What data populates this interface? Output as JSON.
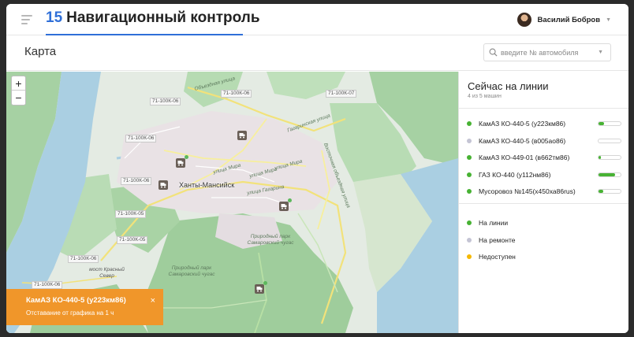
{
  "header": {
    "brand_num": "15",
    "brand_title": "Навигационный контроль",
    "user_name": "Василий Бобров"
  },
  "page": {
    "title": "Карта",
    "search_placeholder": "введите № автомобиля"
  },
  "map": {
    "zoom_in": "+",
    "zoom_out": "−",
    "city": "Ханты-Мансийск",
    "road_labels": [
      "71-100К-06",
      "71-100К-06",
      "71-100К-07",
      "71-100К-06",
      "71-100К-06",
      "71-100К-05",
      "71-100К-06",
      "71-100К-06",
      "71-100К-05"
    ],
    "park_label_1": "Природный парк Самаровский чугас",
    "park_label_2": "Природный парк Самаровский чугас",
    "bridge_label": "мост Красный Север",
    "street_labels": [
      "Объездная улица",
      "Гагаринская улица",
      "улица Мира",
      "улица Мира",
      "улица Мира",
      "Восточная объездная улица",
      "улица Гагарина"
    ]
  },
  "toast": {
    "title": "КамАЗ КО-440-5 (у223км86)",
    "message": "Отставание от графика на 1 ч",
    "close": "×"
  },
  "panel": {
    "title": "Сейчас на линии",
    "subtitle": "4 из 5 машин",
    "vehicles": [
      {
        "name": "КамАЗ КО-440-5 (у223км86)",
        "status_color": "#47b233",
        "progress": 0.25
      },
      {
        "name": "КамАЗ КО-440-5 (в005ао86)",
        "status_color": "#c4c4d4",
        "progress": null
      },
      {
        "name": "КамАЗ КО-449-01 (в662тм86)",
        "status_color": "#47b233",
        "progress": 0.1
      },
      {
        "name": "ГАЗ КО-440 (у112нм86)",
        "status_color": "#47b233",
        "progress": 0.75
      },
      {
        "name": "Мусоровоз №145(х450ха86rus)",
        "status_color": "#47b233",
        "progress": 0.2
      }
    ],
    "legend": [
      {
        "label": "На линии",
        "color": "#47b233"
      },
      {
        "label": "На ремонте",
        "color": "#c4c4d4"
      },
      {
        "label": "Недоступен",
        "color": "#f5b800"
      }
    ]
  }
}
